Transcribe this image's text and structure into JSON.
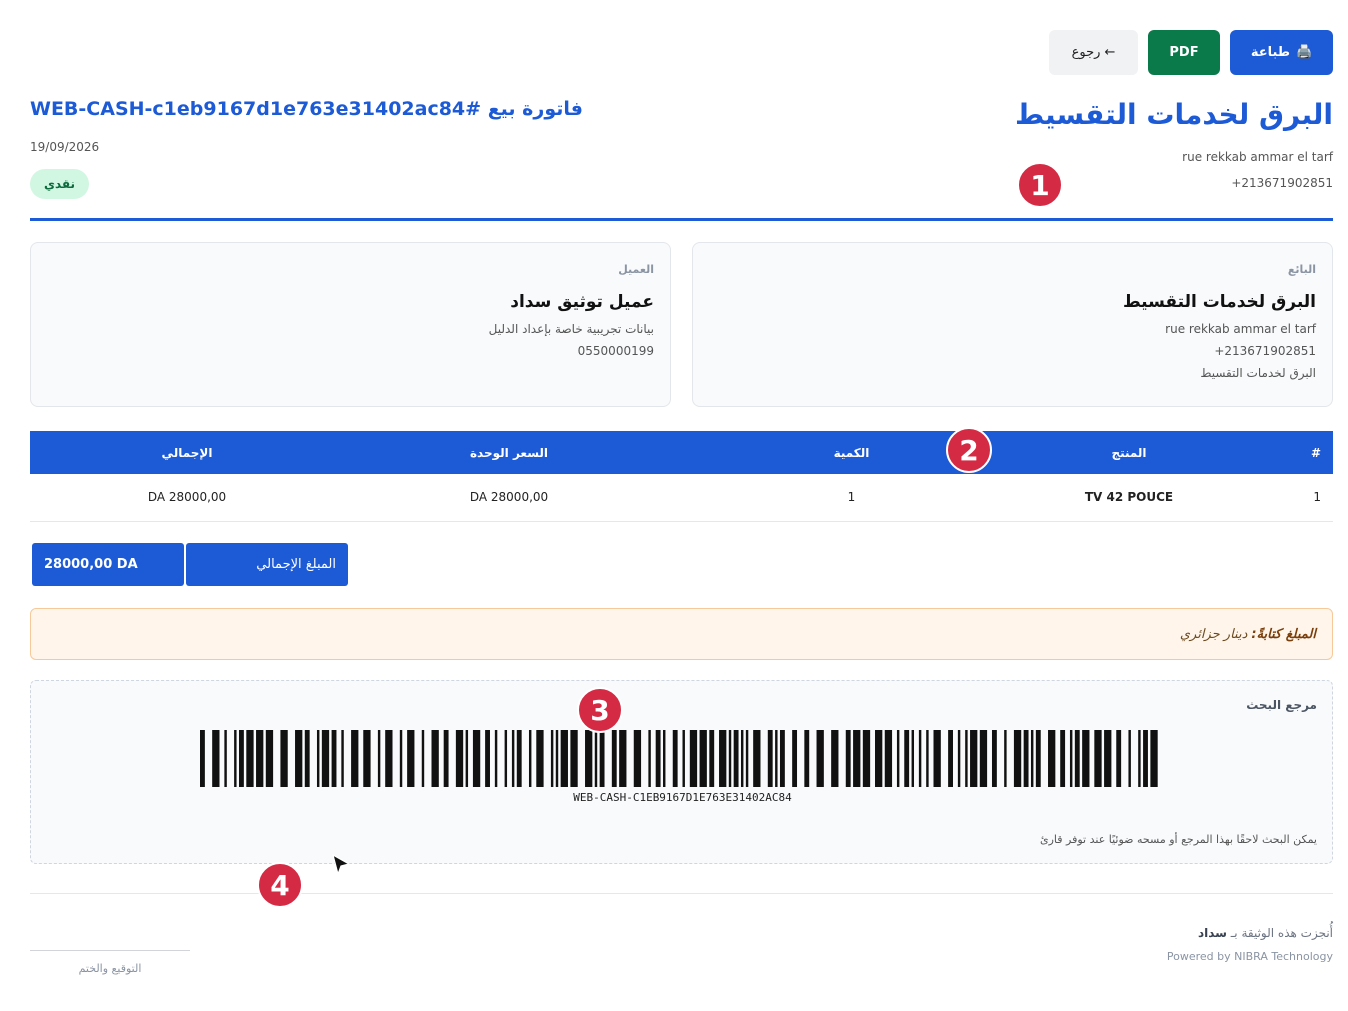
{
  "toolbar": {
    "print_label": "طباعة",
    "print_icon": "🖨️",
    "pdf_label": "PDF",
    "back_label": "← رجوع"
  },
  "header": {
    "brand_name": "البرق لخدمات التقسيط",
    "brand_address": "rue rekkab ammar el tarf",
    "brand_phone": "+213671902851",
    "invoice_title": "فاتورة بيع #WEB-CASH-c1eb9167d1e763e31402ac84",
    "invoice_date": "19/09/2026",
    "payment_badge": "نقدي"
  },
  "seller": {
    "label": "البائع",
    "name": "البرق لخدمات التقسيط",
    "address": "rue rekkab ammar el tarf",
    "phone": "+213671902851",
    "extra": "البرق لخدمات التقسيط"
  },
  "client": {
    "label": "العميل",
    "name": "عميل توثيق سداد",
    "note": "بيانات تجريبية خاصة بإعداد الدليل",
    "phone": "0550000199"
  },
  "table": {
    "headers": [
      "#",
      "المنتج",
      "الكمية",
      "السعر الوحدة",
      "الإجمالي"
    ],
    "rows": [
      {
        "num": "1",
        "product": "TV 42 POUCE",
        "qty": "1",
        "unit_price": "28000,00 DA",
        "total": "28000,00 DA"
      }
    ]
  },
  "totals": {
    "label": "المبلغ الإجمالي",
    "amount": "28000,00 DA"
  },
  "amount_words": {
    "label": "المبلغ كتابةً:",
    "value": "دينار جزائري"
  },
  "barcode": {
    "title": "مرجع البحث",
    "code": "WEB-CASH-C1EB9167D1E763E31402AC84",
    "hint": "يمكن البحث لاحقًا بهذا المرجع أو مسحه ضوئيًا عند توفر قارئ"
  },
  "footer": {
    "generated_prefix": "أُنجزت هذه الوثيقة بـ",
    "generated_brand": "سداد",
    "powered": "Powered by NIBRA Technology",
    "signature_label": "التوقيع والختم"
  },
  "markers": [
    "1",
    "2",
    "3",
    "4"
  ],
  "colors": {
    "primary": "#1d5ad6",
    "pdf": "#0b7a4b",
    "marker": "#d42a44",
    "badge_bg": "#d1f7e2"
  }
}
